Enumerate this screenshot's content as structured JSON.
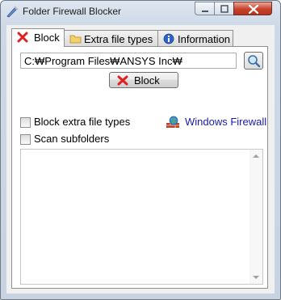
{
  "window": {
    "title": "Folder Firewall Blocker"
  },
  "tabs": [
    {
      "label": "Block",
      "icon": "red-x-icon",
      "active": true
    },
    {
      "label": "Extra file types",
      "icon": "folder-icon",
      "active": false
    },
    {
      "label": "Information",
      "icon": "info-icon",
      "active": false
    }
  ],
  "block_tab": {
    "path_value": "C:₩Program Files₩ANSYS Inc₩",
    "block_button_label": "Block",
    "block_extra_label": "Block extra file types",
    "scan_subfolders_label": "Scan subfolders",
    "windows_firewall_label": "Windows Firewall",
    "block_extra_checked": false,
    "scan_subfolders_checked": false
  },
  "colors": {
    "link": "#1a1ab0",
    "close_button": "#c8412a",
    "block_icon": "#e02020"
  }
}
